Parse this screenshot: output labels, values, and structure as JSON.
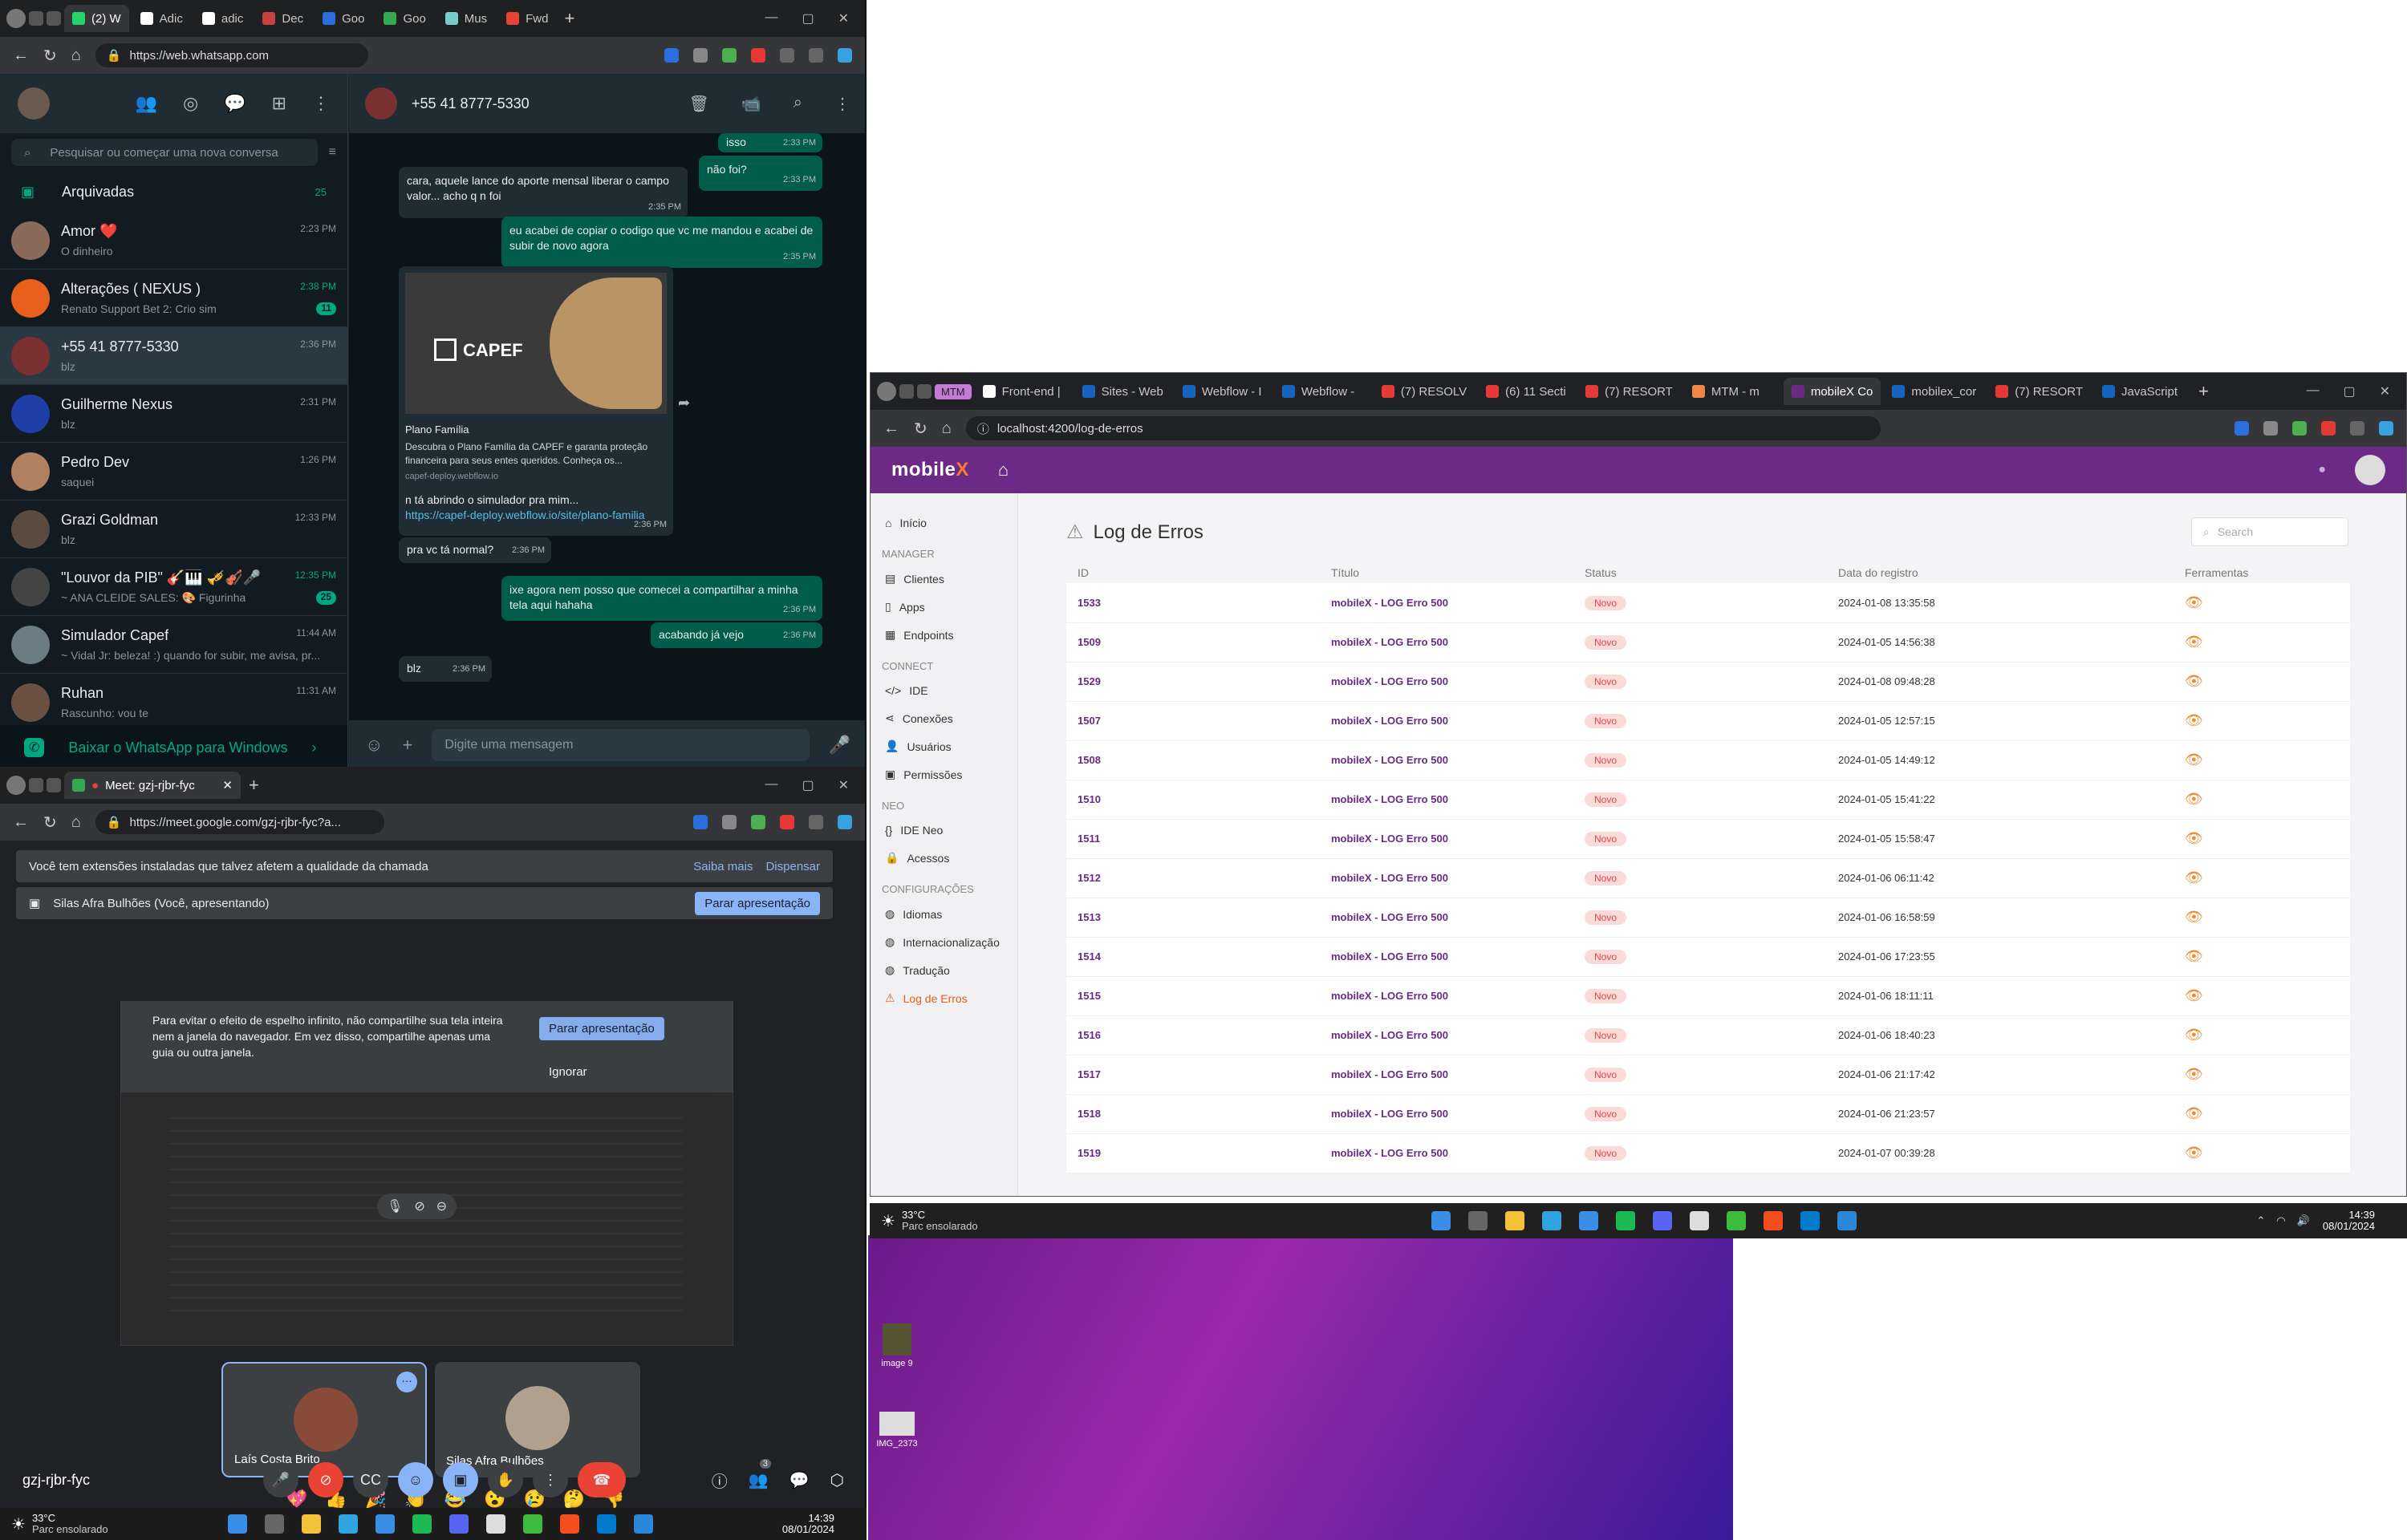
{
  "whatsapp": {
    "tabs": [
      "(2) W",
      "Adic",
      "adic",
      "Dec",
      "Goo",
      "Goo",
      "Mus",
      "Fwd"
    ],
    "url": "https://web.whatsapp.com",
    "search_placeholder": "Pesquisar ou começar uma nova conversa",
    "archived_label": "Arquivadas",
    "archived_count": "25",
    "chats": [
      {
        "name": "Amor ❤️",
        "preview": "O dinheiro",
        "time": "2:23 PM",
        "avatar_color": "#8a6a5a"
      },
      {
        "name": "Alterações ( NEXUS )",
        "preview": "Renato Support Bet 2: Crio sim",
        "time": "2:38 PM",
        "badge": "11",
        "avatar_color": "#e8601c"
      },
      {
        "name": "+55 41 8777-5330",
        "preview": "blz",
        "time": "2:36 PM",
        "avatar_color": "#7a3030",
        "selected": true
      },
      {
        "name": "Guilherme Nexus",
        "preview": "blz",
        "time": "2:31 PM",
        "avatar_color": "#1f3fa8"
      },
      {
        "name": "Pedro Dev",
        "preview": "saquei",
        "time": "1:26 PM",
        "avatar_color": "#b08060"
      },
      {
        "name": "Grazi Goldman",
        "preview": "blz",
        "time": "12:33 PM",
        "avatar_color": "#5a4a40"
      },
      {
        "name": "\"Louvor da PIB\" 🎸🎹 🎺🎻🎤",
        "preview": "~ ANA CLEIDE SALES: 🎨 Figurinha",
        "time": "12:35 PM",
        "badge": "25",
        "avatar_color": "#444"
      },
      {
        "name": "Simulador Capef",
        "preview": "~ Vidal Jr: beleza! :) quando for subir, me avisa, pr...",
        "time": "11:44 AM",
        "avatar_color": "#6b7c85"
      },
      {
        "name": "Ruhan",
        "preview": "Rascunho: vou te",
        "time": "11:31 AM",
        "avatar_color": "#6a5040"
      }
    ],
    "download_label": "Baixar o WhatsApp para Windows",
    "conversation": {
      "contact": "+55 41 8777-5330",
      "messages": [
        {
          "dir": "out",
          "text": "isso",
          "time": "2:33 PM"
        },
        {
          "dir": "out",
          "text": "não foi?",
          "time": "2:33 PM"
        },
        {
          "dir": "in",
          "text": "cara, aquele lance do aporte mensal liberar o campo valor... acho q n foi",
          "time": "2:35 PM"
        },
        {
          "dir": "out",
          "text": "eu acabei de copiar o codigo que vc me mandou e acabei de subir de novo agora",
          "time": "2:35 PM"
        },
        {
          "dir": "in",
          "text": "n tá abrindo o simulador pra mim...",
          "time": "2:36 PM"
        },
        {
          "dir": "in",
          "text": "pra vc tá normal?",
          "time": "2:36 PM"
        },
        {
          "dir": "out",
          "text": "ixe agora nem posso que comecei a compartilhar a minha tela aqui hahaha",
          "time": "2:36 PM"
        },
        {
          "dir": "out",
          "text": "acabando já vejo",
          "time": "2:36 PM"
        },
        {
          "dir": "in",
          "text": "blz",
          "time": "2:36 PM"
        }
      ],
      "link_card": {
        "brand": "CAPEF",
        "title": "Plano Família",
        "desc": "Descubra o Plano Família da CAPEF e garanta proteção financeira para seus entes queridos. Conheça os...",
        "domain": "capef-deploy.webflow.io",
        "url": "https://capef-deploy.webflow.io/site/plano-familia"
      },
      "input_placeholder": "Digite uma mensagem"
    }
  },
  "meet": {
    "tab_title": "Meet: gzj-rjbr-fyc",
    "url": "https://meet.google.com/gzj-rjbr-fyc?a...",
    "ext_banner": "Você tem extensões instaladas que talvez afetem a qualidade da chamada",
    "learn_more": "Saiba mais",
    "dismiss": "Dispensar",
    "presenting": "Silas Afra Bulhões (Você, apresentando)",
    "stop_presenting": "Parar apresentação",
    "mirror_warning": "Para evitar o efeito de espelho infinito, não compartilhe sua tela inteira nem a janela do navegador. Em vez disso, compartilhe apenas uma guia ou outra janela.",
    "stop_presenting_2": "Parar apresentação",
    "ignore": "Ignorar",
    "participants": [
      "Laís Costa Brito",
      "Silas Afra Bulhões"
    ],
    "reactions": [
      "💖",
      "👍",
      "🎉",
      "👏",
      "😂",
      "😮",
      "😢",
      "🤔",
      "👎"
    ],
    "meeting_code": "gzj-rjbr-fyc",
    "people_count": "3"
  },
  "taskbar_bottom": {
    "temp": "33°C",
    "weather": "Parc ensolarado",
    "time": "14:39",
    "date": "08/01/2024"
  },
  "taskbar_right": {
    "temp": "33°C",
    "weather": "Parc ensolarado",
    "time": "14:39",
    "date": "08/01/2024"
  },
  "desktop": {
    "icons": [
      "image 9",
      "IMG_2373"
    ]
  },
  "admin": {
    "tabs": [
      "MTM",
      "Front-end |",
      "Sites - Web",
      "Webflow - I",
      "Webflow -",
      "(7) RESOLV",
      "(6) 11 Secti",
      "(7) RESORT",
      "MTM - m",
      "mobileX Co",
      "mobilex_cor",
      "(7) RESORT",
      "JavaScript"
    ],
    "url": "localhost:4200/log-de-erros",
    "logo_main": "mobile",
    "logo_x": "X",
    "sidebar": {
      "inicio": "Início",
      "sec_manager": "MANAGER",
      "manager": [
        "Clientes",
        "Apps",
        "Endpoints"
      ],
      "sec_connect": "CONNECT",
      "connect": [
        "IDE",
        "Conexões",
        "Usuários",
        "Permissões"
      ],
      "sec_neo": "NEO",
      "neo": [
        "IDE Neo",
        "Acessos"
      ],
      "sec_config": "CONFIGURAÇÕES",
      "config": [
        "Idiomas",
        "Internacionalização",
        "Tradução",
        "Log de Erros"
      ]
    },
    "page_title": "Log de Erros",
    "search_placeholder": "Search",
    "columns": [
      "ID",
      "Título",
      "Status",
      "Data do registro",
      "Ferramentas"
    ],
    "rows": [
      {
        "id": "1533",
        "title": "mobileX - LOG Erro 500",
        "status": "Novo",
        "date": "2024-01-08 13:35:58"
      },
      {
        "id": "1509",
        "title": "mobileX - LOG Erro 500",
        "status": "Novo",
        "date": "2024-01-05 14:56:38"
      },
      {
        "id": "1529",
        "title": "mobileX - LOG Erro 500",
        "status": "Novo",
        "date": "2024-01-08 09:48:28"
      },
      {
        "id": "1507",
        "title": "mobileX - LOG Erro 500",
        "status": "Novo",
        "date": "2024-01-05 12:57:15"
      },
      {
        "id": "1508",
        "title": "mobileX - LOG Erro 500",
        "status": "Novo",
        "date": "2024-01-05 14:49:12"
      },
      {
        "id": "1510",
        "title": "mobileX - LOG Erro 500",
        "status": "Novo",
        "date": "2024-01-05 15:41:22"
      },
      {
        "id": "1511",
        "title": "mobileX - LOG Erro 500",
        "status": "Novo",
        "date": "2024-01-05 15:58:47"
      },
      {
        "id": "1512",
        "title": "mobileX - LOG Erro 500",
        "status": "Novo",
        "date": "2024-01-06 06:11:42"
      },
      {
        "id": "1513",
        "title": "mobileX - LOG Erro 500",
        "status": "Novo",
        "date": "2024-01-06 16:58:59"
      },
      {
        "id": "1514",
        "title": "mobileX - LOG Erro 500",
        "status": "Novo",
        "date": "2024-01-06 17:23:55"
      },
      {
        "id": "1515",
        "title": "mobileX - LOG Erro 500",
        "status": "Novo",
        "date": "2024-01-06 18:11:11"
      },
      {
        "id": "1516",
        "title": "mobileX - LOG Erro 500",
        "status": "Novo",
        "date": "2024-01-06 18:40:23"
      },
      {
        "id": "1517",
        "title": "mobileX - LOG Erro 500",
        "status": "Novo",
        "date": "2024-01-06 21:17:42"
      },
      {
        "id": "1518",
        "title": "mobileX - LOG Erro 500",
        "status": "Novo",
        "date": "2024-01-06 21:23:57"
      },
      {
        "id": "1519",
        "title": "mobileX - LOG Erro 500",
        "status": "Novo",
        "date": "2024-01-07 00:39:28"
      }
    ]
  },
  "colors": {
    "wa_green": "#00a884",
    "admin_purple": "#6a2a86",
    "accent_orange": "#f08a2d",
    "meet_blue": "#8ab4f8"
  }
}
